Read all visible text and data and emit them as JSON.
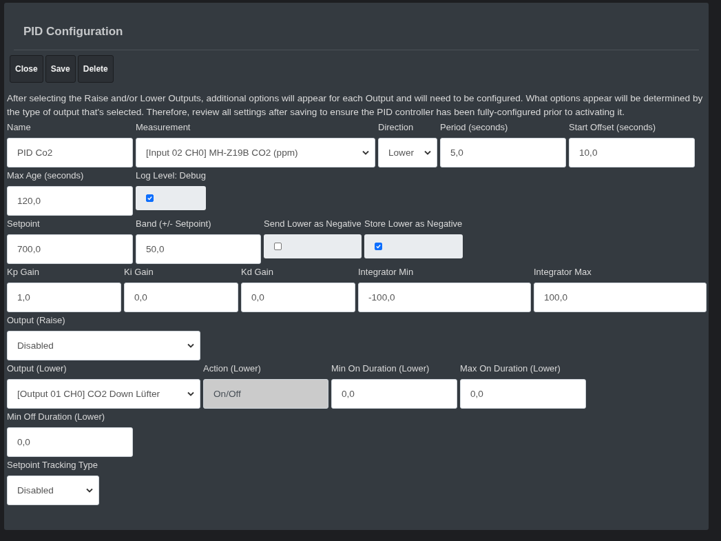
{
  "dialog": {
    "title": "PID Configuration"
  },
  "buttons": [
    "Close",
    "Save",
    "Delete"
  ],
  "description": "After selecting the Raise and/or Lower Outputs, additional options will appear for each Output and will need to be configured. What options appear will be determined by the type of output that's selected. Therefore, review all settings after saving to ensure the PID controller has been fully-configured prior to activating it.",
  "rows": [
    {
      "fields": [
        {
          "kind": "text",
          "label": "Name",
          "value": "PID Co2"
        },
        {
          "kind": "select",
          "label": "Measurement",
          "value": "[Input 02 CH0] MH-Z19B CO2 (ppm)"
        },
        {
          "kind": "select",
          "label": "Direction",
          "value": "Lower"
        },
        {
          "kind": "text",
          "label": "Period (seconds)",
          "value": "5,0"
        },
        {
          "kind": "text",
          "label": "Start Offset (seconds)",
          "value": "10,0"
        }
      ]
    },
    {
      "fields": [
        {
          "kind": "text",
          "label": "Max Age (seconds)",
          "value": "120,0"
        },
        {
          "kind": "checkbox",
          "label": "Log Level: Debug",
          "checked": true
        }
      ]
    },
    {
      "fields": [
        {
          "kind": "text",
          "label": "Setpoint",
          "value": "700,0"
        },
        {
          "kind": "text",
          "label": "Band (+/- Setpoint)",
          "value": "50,0"
        },
        {
          "kind": "checkbox",
          "label": "Send Lower as Negative",
          "checked": false
        },
        {
          "kind": "checkbox",
          "label": "Store Lower as Negative",
          "checked": true
        }
      ]
    },
    {
      "fields": [
        {
          "kind": "text",
          "label": "Kp Gain",
          "value": "1,0"
        },
        {
          "kind": "text",
          "label": "Ki Gain",
          "value": "0,0"
        },
        {
          "kind": "text",
          "label": "Kd Gain",
          "value": "0,0"
        },
        {
          "kind": "text",
          "label": "Integrator Min",
          "value": "-100,0"
        },
        {
          "kind": "text",
          "label": "Integrator Max",
          "value": "100,0"
        }
      ]
    },
    {
      "fields": [
        {
          "kind": "select",
          "label": "Output (Raise)",
          "value": "Disabled"
        }
      ]
    },
    {
      "fields": [
        {
          "kind": "select",
          "label": "Output (Lower)",
          "value": "[Output 01 CH0] CO2 Down Lüfter"
        },
        {
          "kind": "readonly",
          "label": "Action (Lower)",
          "value": "On/Off"
        },
        {
          "kind": "text",
          "label": "Min On Duration (Lower)",
          "value": "0,0"
        },
        {
          "kind": "text",
          "label": "Max On Duration (Lower)",
          "value": "0,0"
        }
      ]
    },
    {
      "fields": [
        {
          "kind": "text",
          "label": "Min Off Duration (Lower)",
          "value": "0,0"
        }
      ]
    },
    {
      "fields": [
        {
          "kind": "select",
          "label": "Setpoint Tracking Type",
          "value": "Disabled"
        }
      ]
    }
  ]
}
